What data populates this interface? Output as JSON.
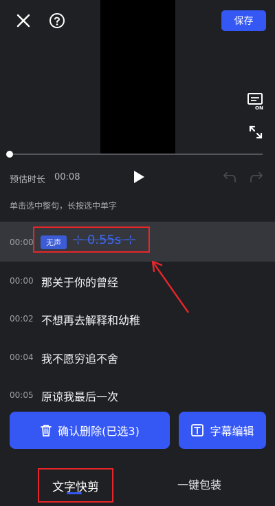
{
  "header": {
    "close_icon": "close-icon",
    "help_icon": "help-icon",
    "save_label": "保存"
  },
  "player": {
    "subtitle_toggle_label": "ON",
    "duration_label": "预估时长",
    "duration_value": "00:08",
    "progress": 0.0
  },
  "hint": "单击选中整句，长按选中单字",
  "subtitles": [
    {
      "time": "00:00",
      "badge": "无声",
      "text": "0.55s",
      "silent": true,
      "selected": true
    },
    {
      "time": "00:00",
      "text": "那关于你的曾经"
    },
    {
      "time": "00:02",
      "text": "不想再去解释和幼稚"
    },
    {
      "time": "00:04",
      "text": "我不愿穷追不舍"
    },
    {
      "time": "00:05",
      "text": "原谅我最后一次"
    }
  ],
  "actions": {
    "confirm_delete_label": "确认删除(已选3)",
    "subtitle_edit_label": "字幕编辑"
  },
  "tabs": [
    {
      "label": "文字快剪",
      "active": true
    },
    {
      "label": "一键包装",
      "active": false
    }
  ],
  "colors": {
    "accent": "#3558f5",
    "annotation": "#e8262a",
    "background": "#1f2024"
  }
}
